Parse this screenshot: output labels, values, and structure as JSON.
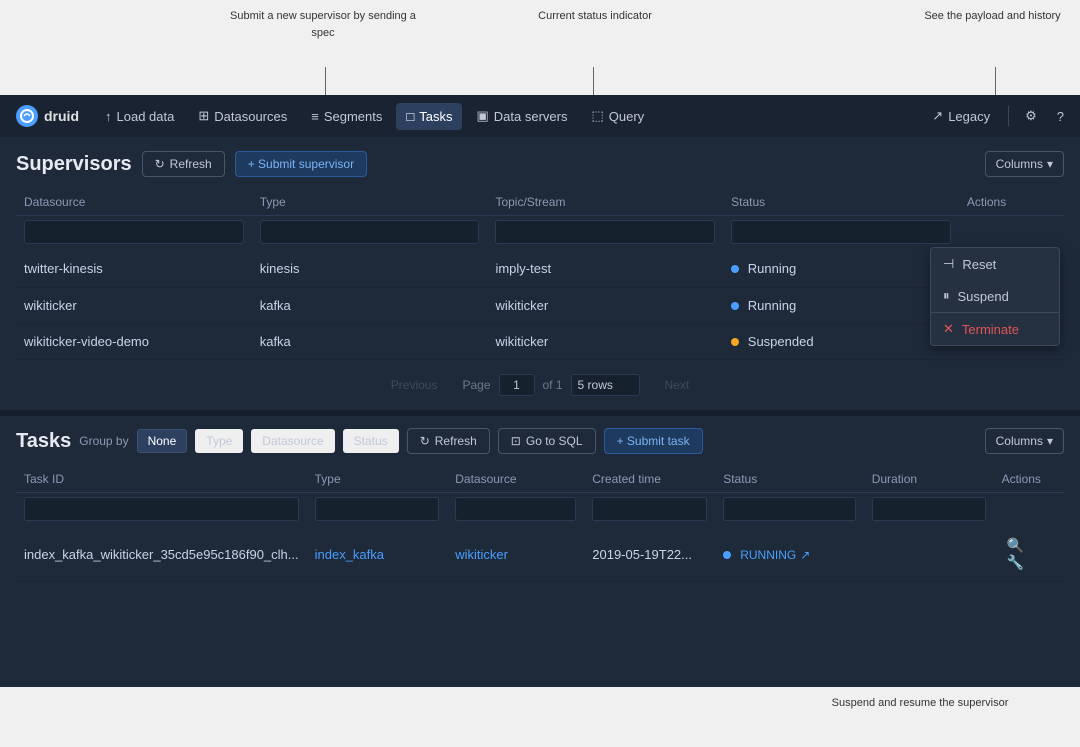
{
  "annotations": {
    "submit_supervisor": "Submit a new supervisor\nby sending a spec",
    "current_status": "Current status\nindicator",
    "payload_history": "See the payload\nand history",
    "suspend_resume": "Suspend and resume\nthe supervisor"
  },
  "nav": {
    "logo_text": "druid",
    "items": [
      {
        "label": "Load data",
        "icon": "↑",
        "active": false
      },
      {
        "label": "Datasources",
        "icon": "⊞",
        "active": false
      },
      {
        "label": "Segments",
        "icon": "≡",
        "active": false
      },
      {
        "label": "Tasks",
        "icon": "□",
        "active": true
      },
      {
        "label": "Data servers",
        "icon": "▣",
        "active": false
      },
      {
        "label": "Query",
        "icon": "⬚",
        "active": false
      }
    ],
    "right_items": [
      "Legacy",
      "⚙",
      "?"
    ]
  },
  "supervisors": {
    "title": "Supervisors",
    "refresh_btn": "Refresh",
    "submit_btn": "+ Submit supervisor",
    "columns_btn": "Columns",
    "columns": [
      "Datasource",
      "Type",
      "Topic/Stream",
      "Status",
      "Actions"
    ],
    "rows": [
      {
        "datasource": "twitter-kinesis",
        "type": "kinesis",
        "topic": "imply-test",
        "status": "Running",
        "status_color": "running"
      },
      {
        "datasource": "wikiticker",
        "type": "kafka",
        "topic": "wikiticker",
        "status": "Running",
        "status_color": "running"
      },
      {
        "datasource": "wikiticker-video-demo",
        "type": "kafka",
        "topic": "wikiticker",
        "status": "Suspended",
        "status_color": "suspended"
      }
    ],
    "context_menu": {
      "items": [
        {
          "icon": "⊣",
          "label": "Reset",
          "danger": false
        },
        {
          "icon": "⏸",
          "label": "Suspend",
          "danger": false
        },
        {
          "icon": "✕",
          "label": "Terminate",
          "danger": true
        }
      ]
    },
    "pagination": {
      "previous_btn": "Previous",
      "next_btn": "Next",
      "page_label": "Page",
      "current_page": "1",
      "total_pages": "of 1",
      "rows_label": "5 rows"
    }
  },
  "tasks": {
    "title": "Tasks",
    "group_by_label": "Group by",
    "group_buttons": [
      "None",
      "Type",
      "Datasource",
      "Status"
    ],
    "refresh_btn": "Refresh",
    "go_to_sql_btn": "Go to SQL",
    "submit_task_btn": "+ Submit task",
    "columns_btn": "Columns",
    "columns": [
      "Task ID",
      "Type",
      "Datasource",
      "Created time",
      "Status",
      "Duration",
      "Actions"
    ],
    "rows": [
      {
        "id": "index_kafka_wikiticker_35cd5e95c186f90_clh...",
        "type": "index_kafka",
        "datasource": "wikiticker",
        "created_time": "2019-05-19T22...",
        "status": "RUNNING",
        "duration": "",
        "status_color": "running"
      }
    ]
  }
}
